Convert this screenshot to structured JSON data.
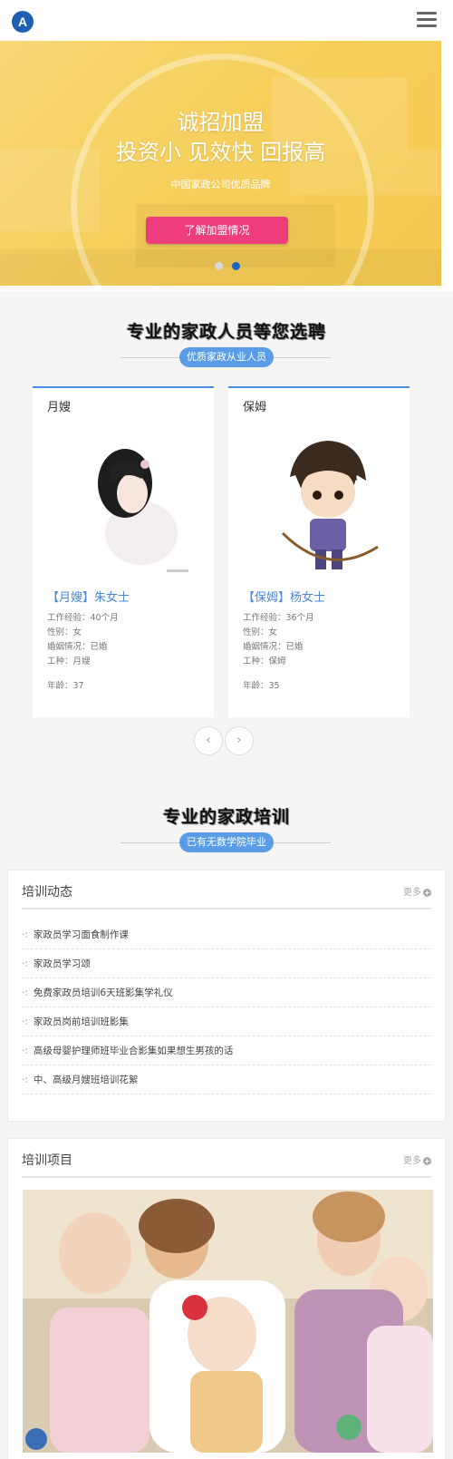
{
  "header": {
    "logo_letter": "A"
  },
  "banner": {
    "headline1": "诚招加盟",
    "headline2": "投资小 见效快 回报高",
    "subtitle": "中国家政公司优质品牌",
    "cta_label": "了解加盟情况"
  },
  "staff": {
    "title": "专业的家政人员等您选聘",
    "pill": "优质家政从业人员",
    "cards": [
      {
        "category": "月嫂",
        "name": "【月嫂】朱女士",
        "experience": "工作经验：40个月",
        "gender": "性别：女",
        "marital": "婚姻情况：已婚",
        "job": "工种：月嫂",
        "age": "年龄：37"
      },
      {
        "category": "保姆",
        "name": "【保姆】杨女士",
        "experience": "工作经验：36个月",
        "gender": "性别：女",
        "marital": "婚姻情况：已婚",
        "job": "工种：保姆",
        "age": "年龄：35"
      }
    ],
    "prev": "‹",
    "next": "›"
  },
  "training": {
    "title": "专业的家政培训",
    "pill": "已有无数学院毕业",
    "news_panel": {
      "title": "培训动态",
      "more": "更多",
      "bullet": "·:",
      "items": [
        "家政员学习面食制作课",
        "家政员学习颂",
        "免费家政员培训6天班影集学礼仪",
        "家政员岗前培训班影集",
        "高级母婴护理师班毕业合影集如果想生男孩的话",
        "中、高级月嫂班培训花絮"
      ]
    },
    "project_panel": {
      "title": "培训项目",
      "more": "更多"
    }
  },
  "colors": {
    "accent": "#4a90e2",
    "cta": "#ee3d7d",
    "banner": "#f6cf5c"
  }
}
